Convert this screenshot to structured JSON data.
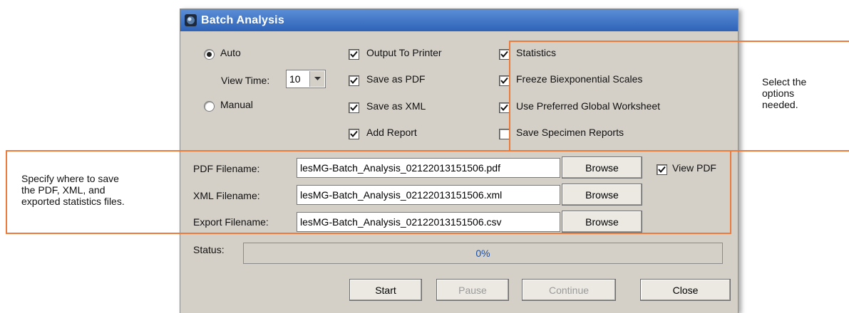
{
  "window": {
    "title": "Batch Analysis"
  },
  "mode": {
    "auto_label": "Auto",
    "view_time_label": "View Time:",
    "view_time_value": "10",
    "manual_label": "Manual",
    "selected": "Auto"
  },
  "options": {
    "output_to_printer": {
      "label": "Output To Printer",
      "checked": true
    },
    "save_as_pdf": {
      "label": "Save as PDF",
      "checked": true
    },
    "save_as_xml": {
      "label": "Save as XML",
      "checked": true
    },
    "add_report": {
      "label": "Add Report",
      "checked": true
    },
    "statistics": {
      "label": "Statistics",
      "checked": true
    },
    "freeze_biexponential": {
      "label": "Freeze Biexponential Scales",
      "checked": true
    },
    "use_preferred_worksheet": {
      "label": "Use Preferred Global Worksheet",
      "checked": true
    },
    "save_specimen_reports": {
      "label": "Save Specimen Reports",
      "checked": false
    }
  },
  "files": {
    "pdf_label": "PDF Filename:",
    "pdf_value": "lesMG-Batch_Analysis_02122013151506.pdf",
    "xml_label": "XML Filename:",
    "xml_value": "lesMG-Batch_Analysis_02122013151506.xml",
    "export_label": "Export Filename:",
    "export_value": "lesMG-Batch_Analysis_02122013151506.csv",
    "browse_label": "Browse",
    "view_pdf_label": "View PDF",
    "view_pdf_checked": true
  },
  "status": {
    "label": "Status:",
    "progress_text": "0%",
    "progress": 0
  },
  "buttons": {
    "start": "Start",
    "pause": "Pause",
    "continue": "Continue",
    "close": "Close"
  },
  "annotations": {
    "options_note_1": "Select the",
    "options_note_2": "options",
    "options_note_3": "needed.",
    "files_note_1": "Specify where to save",
    "files_note_2": "the PDF, XML, and",
    "files_note_3": "exported statistics files."
  },
  "colors": {
    "highlight": "#ec7a3a",
    "titlebar": "#2e63b8",
    "progress_text": "#1f4fa0"
  }
}
